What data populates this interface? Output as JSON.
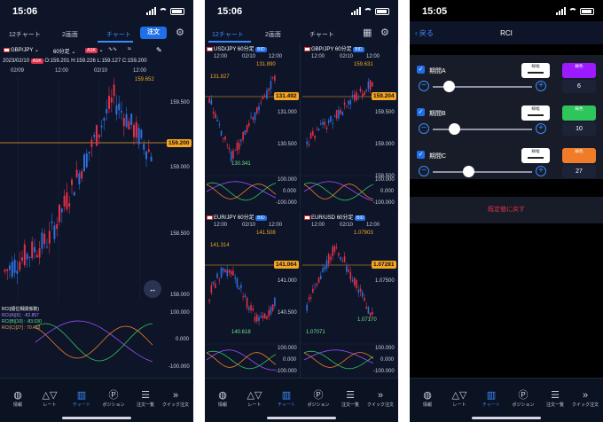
{
  "colors": {
    "bg": "#0e1528",
    "accent": "#3a8bff",
    "price_line": "#f5a623",
    "up_candle": "#e8304a",
    "down_candle": "#2f6fe0"
  },
  "panel1": {
    "time": "15:06",
    "tabs": [
      "12チャート",
      "2画面",
      "チャート"
    ],
    "order_button": "注文",
    "symbol": "GBP/JPY",
    "timeframe": "60分足",
    "chip_ask": "ASK",
    "info_date": "2023/02/10",
    "info_ohlc": [
      "O:159.201",
      "H:159.226",
      "L:159.127",
      "C:159.200"
    ],
    "x_top_labels": [
      "02/09",
      "12:00",
      "02/10",
      "12:00"
    ],
    "x_mid_labels": [
      "02/10",
      "12:00"
    ],
    "high_label": "159.652",
    "current_price": "159.200",
    "y_labels": [
      "159.500",
      "159.000",
      "158.500",
      "158.000"
    ],
    "rci_title": "RCI(順位相関係数)",
    "rci_values": [
      "[6] : -82.857",
      "[10] : -83.030",
      "[27] : 70.452"
    ],
    "rci_legend_colors": [
      "#9b4dff",
      "#2ec55c",
      "#f07c2a"
    ],
    "rci_axis": [
      "100.000",
      "0.000",
      "-100.000"
    ]
  },
  "panel2": {
    "time": "15:06",
    "tabs": [
      "12チャート",
      "2画面",
      "チャート"
    ],
    "charts": [
      {
        "symbol": "USD/JPY",
        "timeframe": "60分足",
        "x_labels": [
          "12:00",
          "02/10",
          "12:00"
        ],
        "high": "131.890",
        "left_level": "131.827",
        "current": "131.492",
        "low": "130.341",
        "y_labels": [
          "131.000",
          "130.500"
        ],
        "rci_axis": [
          "100.000",
          "0.000",
          "-100.000"
        ]
      },
      {
        "symbol": "GBP/JPY",
        "timeframe": "60分足",
        "x_labels": [
          "12:00",
          "02/10",
          "12:00"
        ],
        "high": "159.631",
        "current": "159.204",
        "y_labels": [
          "159.500",
          "159.000",
          "158.500"
        ],
        "rci_axis": [
          "100.000",
          "0.000",
          "-100.000"
        ]
      },
      {
        "symbol": "EUR/JPY",
        "timeframe": "60分足",
        "x_labels": [
          "12:00",
          "02/10",
          "12:00"
        ],
        "high": "141.508",
        "left_level": "141.314",
        "current": "141.064",
        "low": "140.618",
        "y_labels": [
          "141.000",
          "140.500"
        ],
        "rci_axis": [
          "100.000",
          "0.000",
          "-100.000"
        ]
      },
      {
        "symbol": "EUR/USD",
        "timeframe": "60分足",
        "x_labels": [
          "12:00",
          "02/10",
          "12:00"
        ],
        "high": "1.07903",
        "current": "1.07281",
        "low": "1.07071",
        "low2": "1.07170",
        "y_labels": [
          "1.07500"
        ],
        "rci_axis": [
          "100.000",
          "0.000",
          "-100.000"
        ]
      }
    ],
    "chip_bid": "BID"
  },
  "panel3": {
    "time": "15:05",
    "back": "戻る",
    "title": "RCI",
    "periods": [
      {
        "label": "期間A",
        "width_label": "線幅",
        "color_label": "線色",
        "color": "#9b1aff",
        "value": "6",
        "slider_pct": 0.05
      },
      {
        "label": "期間B",
        "width_label": "線幅",
        "color_label": "線色",
        "color": "#2ec55c",
        "value": "10",
        "slider_pct": 0.1
      },
      {
        "label": "期間C",
        "width_label": "線幅",
        "color_label": "線色",
        "color": "#f07c2a",
        "value": "27",
        "slider_pct": 0.24
      }
    ],
    "reset": "既定値に戻す"
  },
  "bottom_nav": [
    {
      "label": "情報",
      "icon": "globe-icon"
    },
    {
      "label": "レート",
      "icon": "rate-icon"
    },
    {
      "label": "チャート",
      "icon": "chart-icon"
    },
    {
      "label": "ポジション",
      "icon": "position-icon"
    },
    {
      "label": "注文一覧",
      "icon": "order-list-icon"
    },
    {
      "label": "クイック注文",
      "icon": "quick-order-icon"
    }
  ]
}
